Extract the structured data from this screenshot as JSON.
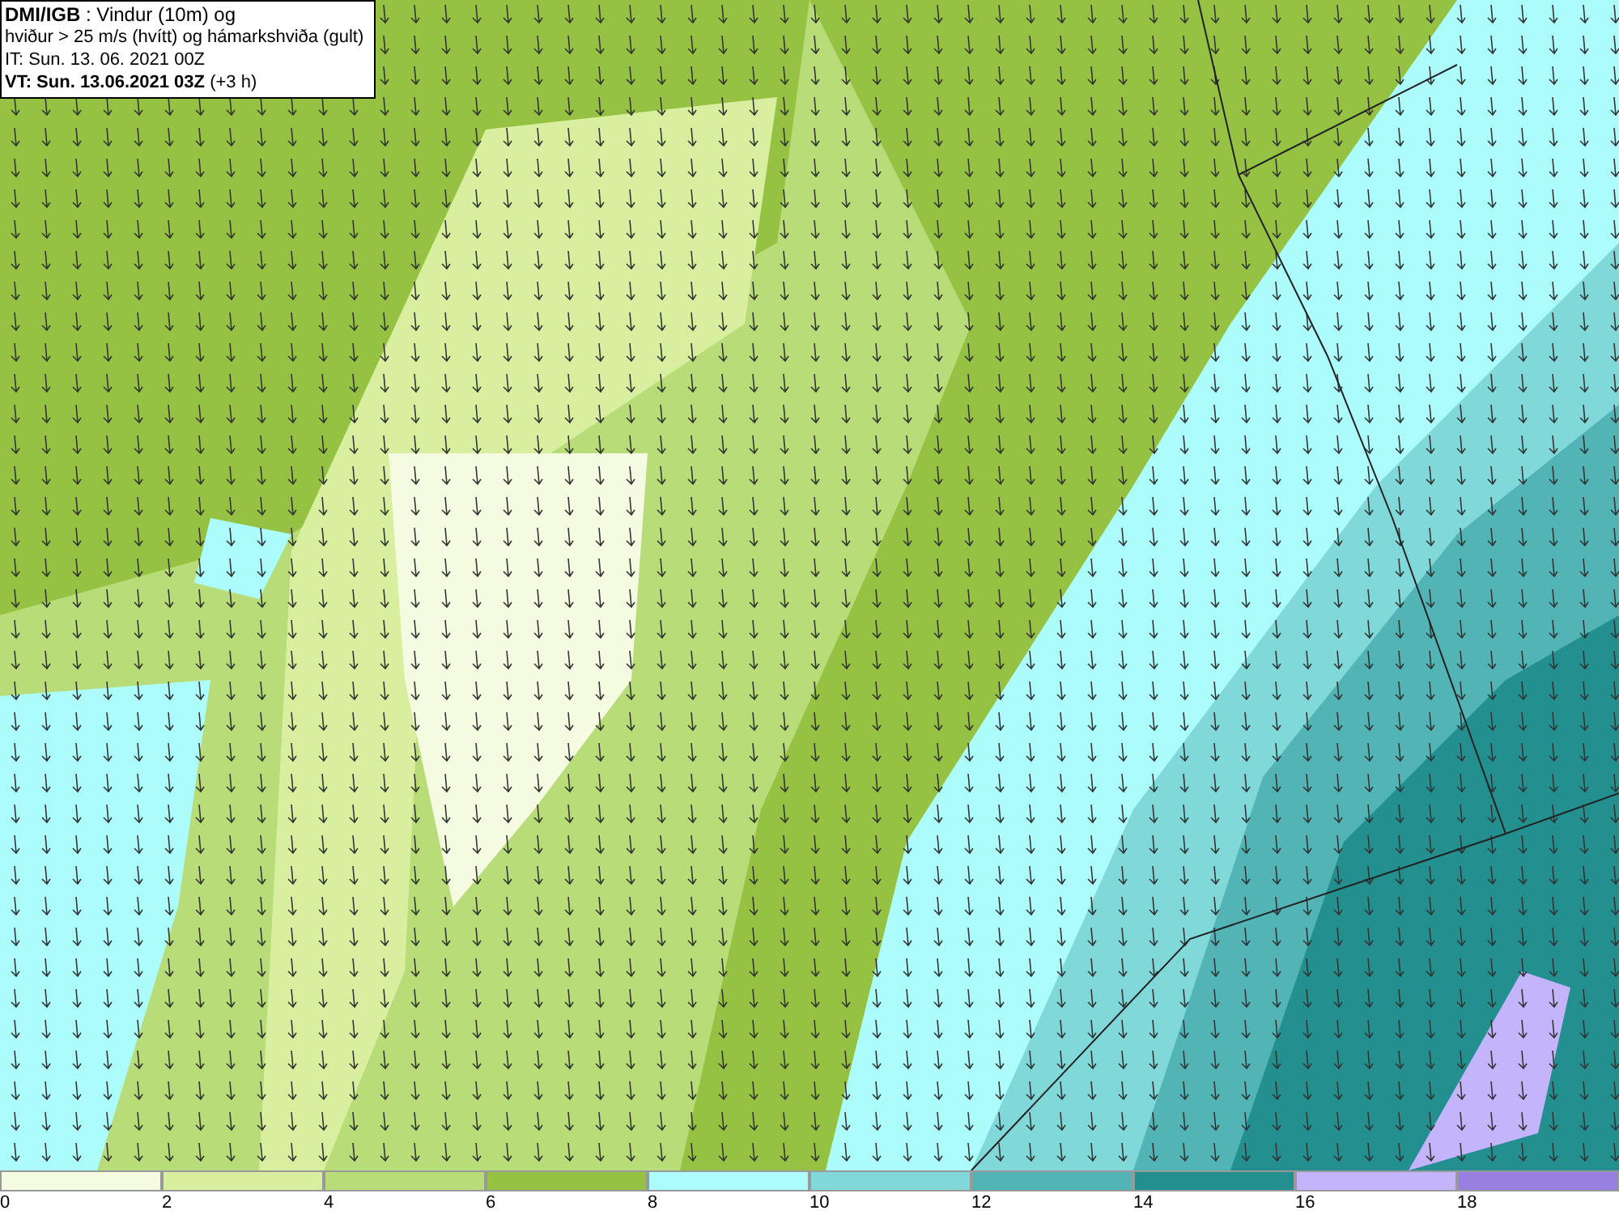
{
  "title_box": {
    "lines": [
      "**DMI/IGB** : Vindur (10m) og",
      "hviður > 25 m/s (hvítt) og hámarkshviða (gult)",
      "IT: Sun. 13. 06. 2021 00Z",
      "**VT: Sun. 13.06.2021 03Z** (+3 h)"
    ]
  },
  "legend": {
    "bins": [
      {
        "color": "#f5fbe0"
      },
      {
        "color": "#d9efa0"
      },
      {
        "color": "#b7dc78"
      },
      {
        "color": "#96c244"
      },
      {
        "color": "#acfcfc"
      },
      {
        "color": "#80d8d8"
      },
      {
        "color": "#52b4b4"
      },
      {
        "color": "#248f8f"
      },
      {
        "color": "#c4b4fc"
      },
      {
        "color": "#9880e0"
      }
    ],
    "ticks": [
      "0",
      "2",
      "4",
      "6",
      "8",
      "10",
      "12",
      "14",
      "16",
      "18"
    ]
  }
}
